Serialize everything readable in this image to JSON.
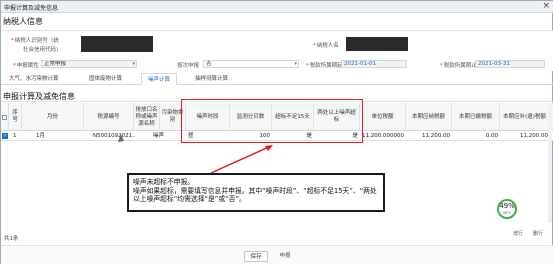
{
  "window": {
    "title": "申报计算及减免信息",
    "close_glyph": "×"
  },
  "taxpayer_section": {
    "heading": "纳税人信息"
  },
  "fields": {
    "taxpayer_id_label": "纳税人识别号（统",
    "taxpayer_name_label": "纳税人名",
    "social_credit_label": "社会信用代码)",
    "declare_attr_label": "申报属性",
    "declare_attr_value": "正常申报",
    "by_times_label": "按次申报",
    "by_times_value": "否",
    "period_start_label": "税款所属期起",
    "period_start_value": "2021-01-01",
    "period_end_label": "税款所属期止",
    "period_end_value": "2021-03-31"
  },
  "tabs": [
    {
      "label": "大气、水污染物计算"
    },
    {
      "label": "固体废物计算"
    },
    {
      "label": "噪声计算"
    },
    {
      "label": "抽样测算计算"
    }
  ],
  "grid_section": {
    "heading": "申报计算及减免信息"
  },
  "columns": {
    "seq": "序号",
    "month": "月份",
    "tax_code": "税源编号",
    "outlet": "排放口名称或噪声源名称",
    "pollutant": "污染物类别",
    "noise_period": "噪声时段",
    "monitor_db": "监测分贝数",
    "over_15_days": "超标不足15天",
    "two_places": "两处以上噪声超标",
    "unit_tax": "单位税额",
    "tax_payable": "本期应纳税额",
    "tax_paid": "本期已缴税额",
    "tax_due": "本期应补(退)税额"
  },
  "rows": [
    {
      "checked": "✓",
      "seq": "1",
      "month": "1月",
      "tax_code": "N5001092021...",
      "outlet": "",
      "pollutant": "噪声",
      "noise_period": "昼",
      "monitor_db": "100",
      "over_15_days": "是",
      "two_places": "是",
      "unit_tax": "11,200.000000",
      "tax_payable": "11,200.00",
      "tax_paid": "0.00",
      "tax_due": "11,200.00"
    }
  ],
  "annotation": {
    "line1": "噪声未超标不申报。",
    "line2": "噪声如果超标，需要填写信息并申报。其中“噪声时段”、“超标不足15天”、“两处以上噪声超标”均需选择“是”或“否”。"
  },
  "badge": {
    "percent": "49%",
    "sub": "46°C"
  },
  "row_actions": {
    "add": "增行",
    "delete": "删行"
  },
  "footer": {
    "count": "共1条",
    "save_label": "保存",
    "declare_label": "申报"
  },
  "colors": {
    "highlight": "#e21c1c",
    "accent": "#1a73c9",
    "badge_ring": "#3ab54a"
  }
}
